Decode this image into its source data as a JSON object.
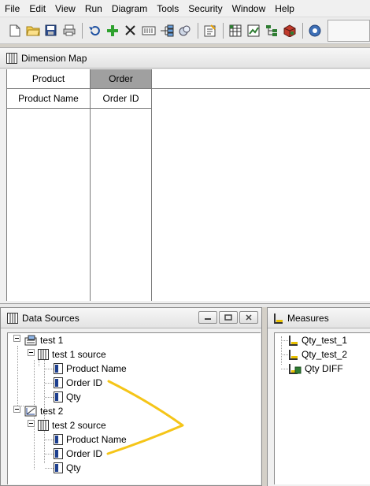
{
  "menu": [
    "File",
    "Edit",
    "View",
    "Run",
    "Diagram",
    "Tools",
    "Security",
    "Window",
    "Help"
  ],
  "toolbar": {
    "icons": [
      "new-icon",
      "open-folder-icon",
      "save-icon",
      "print-icon",
      "undo-icon",
      "add-icon",
      "delete-icon",
      "dimension-icon",
      "hierarchy-icon",
      "link-icon",
      "edit-properties-icon",
      "grid-icon",
      "chart-icon",
      "tree-icon",
      "cube-icon",
      "help-circle-icon"
    ]
  },
  "dimension_map": {
    "title": "Dimension Map",
    "columns": [
      {
        "header": "Product",
        "value": "Product Name",
        "selected": false
      },
      {
        "header": "Order",
        "value": "Order ID",
        "selected": true
      }
    ]
  },
  "data_sources": {
    "title": "Data Sources",
    "tree": [
      {
        "label": "test 1",
        "source": "test 1 source",
        "fields": [
          "Product Name",
          "Order ID",
          "Qty"
        ]
      },
      {
        "label": "test 2",
        "source": "test 2 source",
        "fields": [
          "Product Name",
          "Order ID",
          "Qty"
        ]
      }
    ]
  },
  "measures": {
    "title": "Measures",
    "items": [
      "Qty_test_1",
      "Qty_test_2",
      "Qty DIFF"
    ]
  },
  "colors": {
    "annotation": "#f5c518",
    "selected_header": "#a0a0a0"
  }
}
